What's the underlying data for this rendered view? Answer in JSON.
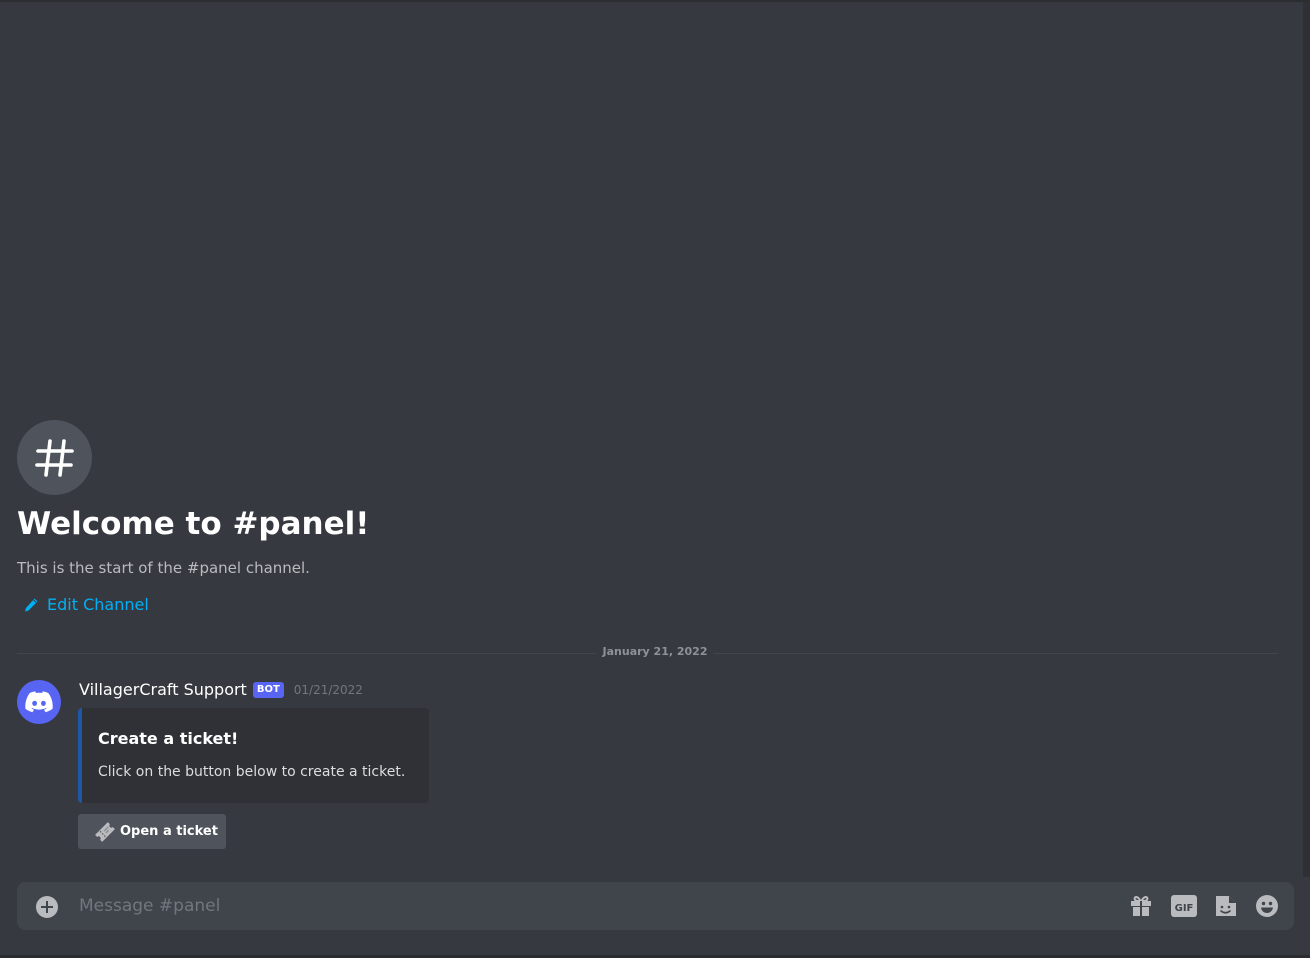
{
  "channel": {
    "name": "panel",
    "icon": "hash-icon",
    "welcome_title": "Welcome to #panel!",
    "welcome_subtitle": "This is the start of the #panel channel.",
    "edit_label": "Edit Channel"
  },
  "divider": {
    "date": "January 21, 2022"
  },
  "message": {
    "username": "VillagerCraft Support",
    "bot_tag": "BOT",
    "timestamp": "01/21/2022",
    "avatar_icon": "discord-logo-icon",
    "embed": {
      "title": "Create a ticket!",
      "description": "Click on the button below to create a ticket.",
      "accent_color": "#1f57a7"
    },
    "button": {
      "label": "Open a ticket",
      "icon": "ticket-icon"
    }
  },
  "composer": {
    "placeholder": "Message #panel",
    "value": "",
    "tools": [
      "add-icon",
      "gift-icon",
      "gif-icon",
      "sticker-icon",
      "emoji-icon"
    ]
  },
  "colors": {
    "background": "#36393f",
    "link": "#00b0f4",
    "blurple": "#5865f2",
    "composer": "#40444b"
  }
}
